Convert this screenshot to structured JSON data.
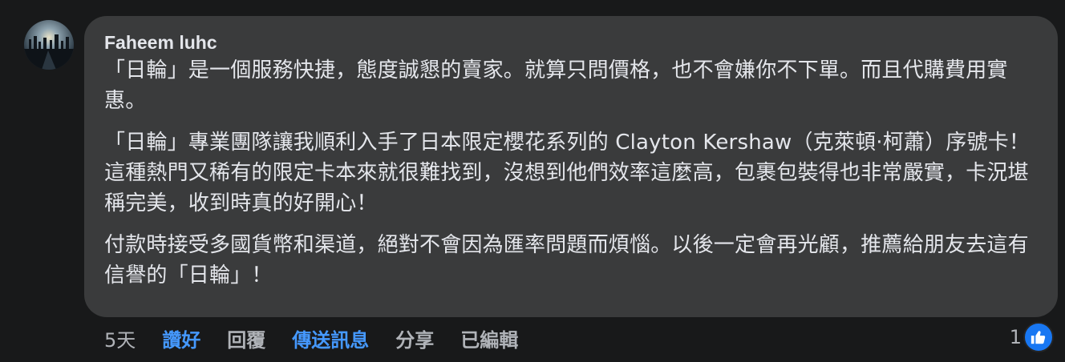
{
  "comment": {
    "author": "Faheem luhc",
    "paragraphs": [
      "「日輪」是一個服務快捷，態度誠懇的賣家。就算只問價格，也不會嫌你不下單。而且代購費用實惠。",
      "「日輪」專業團隊讓我順利入手了日本限定櫻花系列的 Clayton Kershaw（克萊頓·柯蕭）序號卡！這種熱門又稀有的限定卡本來就很難找到，沒想到他們效率這麼高，包裹包裝得也非常嚴實，卡況堪稱完美，收到時真的好開心！",
      "付款時接受多國貨幣和渠道，絕對不會因為匯率問題而煩惱。以後一定會再光顧，推薦給朋友去這有信譽的「日輪」！"
    ]
  },
  "actions": {
    "time": "5天",
    "like": "讚好",
    "reply": "回覆",
    "send_message": "傳送訊息",
    "share": "分享",
    "edited": "已編輯"
  },
  "reactions": {
    "count": "1",
    "icon": "thumbs-up-icon",
    "color": "#1877f2"
  },
  "colors": {
    "background": "#18191a",
    "bubble": "#3a3b3c",
    "text": "#e4e6eb",
    "secondary_text": "#b0b3b8",
    "link": "#4599ff"
  }
}
